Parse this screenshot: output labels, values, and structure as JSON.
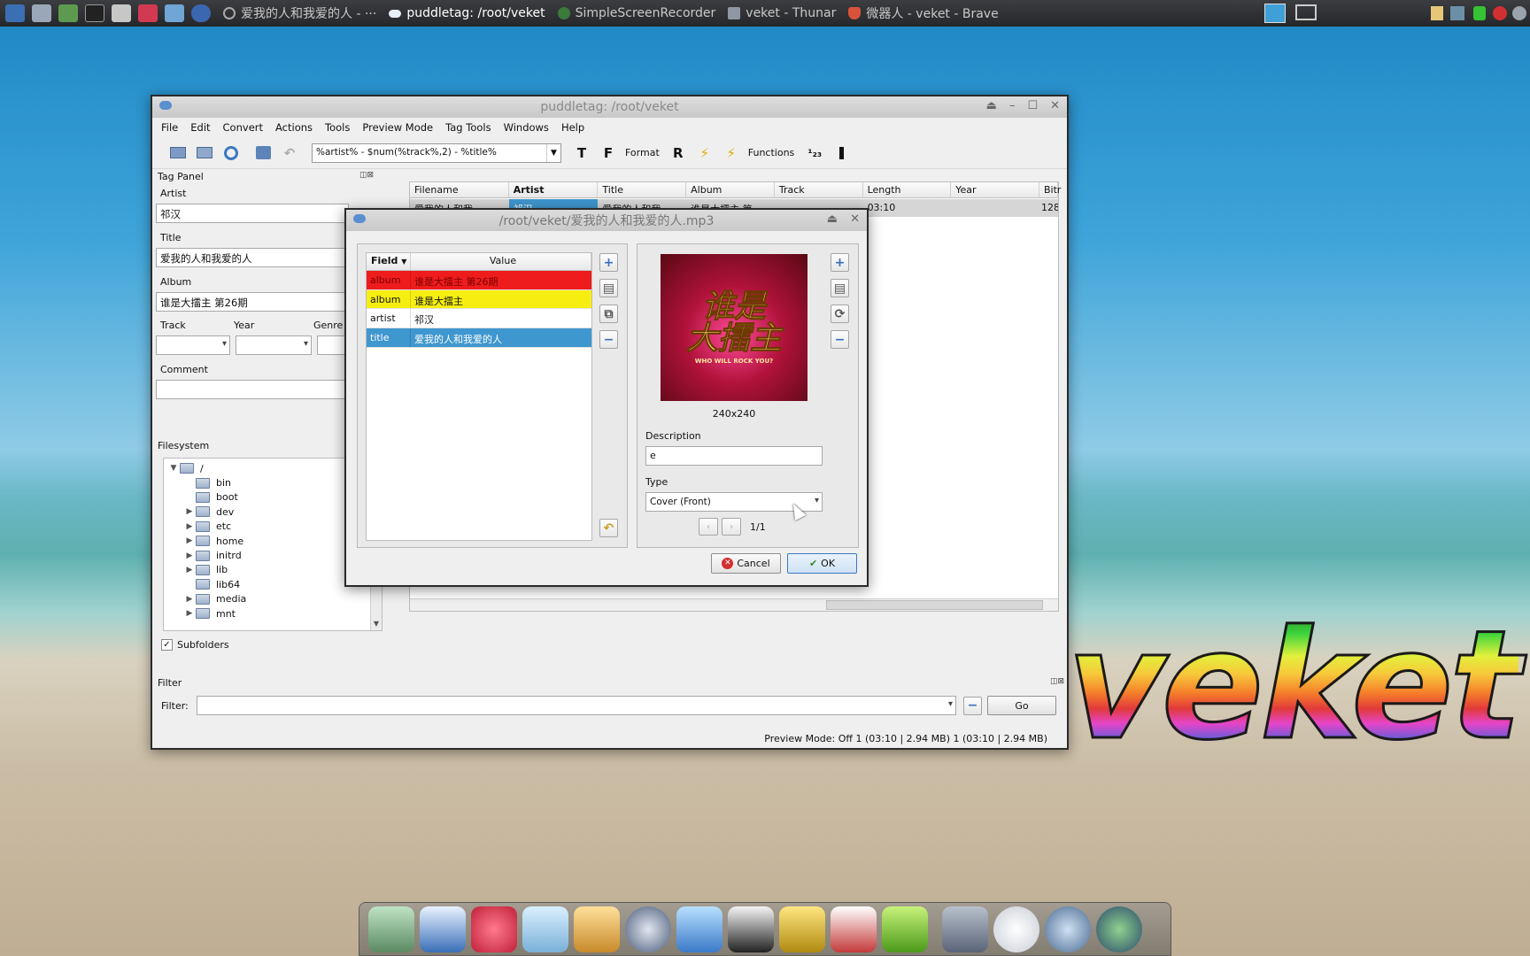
{
  "taskbar": {
    "tasks": [
      {
        "label": "爱我的人和我爱的人 - ···",
        "icon": "circle-icon"
      },
      {
        "label": "puddletag: /root/veket",
        "icon": "cloud-icon"
      },
      {
        "label": "SimpleScreenRecorder",
        "icon": "recorder-icon"
      },
      {
        "label": "veket - Thunar",
        "icon": "folder-icon"
      },
      {
        "label": "微器人 - veket - Brave",
        "icon": "brave-icon"
      }
    ]
  },
  "main": {
    "title": "puddletag: /root/veket",
    "menu": [
      "File",
      "Edit",
      "Convert",
      "Actions",
      "Tools",
      "Preview Mode",
      "Tag Tools",
      "Windows",
      "Help"
    ],
    "format_value": "%artist% - $num(%track%,2) - %title%",
    "format_label": "Format",
    "functions_label": "Functions",
    "tag_panel": {
      "title": "Tag Panel",
      "artist_label": "Artist",
      "artist_value": "祁汉",
      "title_label": "Title",
      "title_value": "爱我的人和我爱的人",
      "album_label": "Album",
      "album_value": "谁是大擂主 第26期",
      "track_label": "Track",
      "year_label": "Year",
      "genre_label": "Genre",
      "comment_label": "Comment"
    },
    "filesystem": {
      "title": "Filesystem",
      "root": "/",
      "items": [
        {
          "name": "bin",
          "expandable": false
        },
        {
          "name": "boot",
          "expandable": false
        },
        {
          "name": "dev",
          "expandable": true
        },
        {
          "name": "etc",
          "expandable": true
        },
        {
          "name": "home",
          "expandable": true
        },
        {
          "name": "initrd",
          "expandable": true
        },
        {
          "name": "lib",
          "expandable": true
        },
        {
          "name": "lib64",
          "expandable": false
        },
        {
          "name": "media",
          "expandable": true
        },
        {
          "name": "mnt",
          "expandable": true
        }
      ],
      "subfolders_label": "Subfolders"
    },
    "table": {
      "headers": [
        "Filename",
        "Artist",
        "Title",
        "Album",
        "Track",
        "Length",
        "Year",
        "Bitr"
      ],
      "row": {
        "filename": "爱我的人和我",
        "artist": "祁汉",
        "title": "爱我的人和我",
        "album": "谁是大擂主 第",
        "track": "",
        "length": "03:10",
        "year": "",
        "bitrate": "128"
      }
    },
    "filter": {
      "title": "Filter",
      "label": "Filter:",
      "go_label": "Go"
    },
    "status": "Preview Mode: Off  1 (03:10 | 2.94 MB)  1 (03:10 | 2.94 MB)"
  },
  "dialog": {
    "title": "/root/veket/爱我的人和我爱的人.mp3",
    "headers": {
      "field": "Field",
      "value": "Value"
    },
    "rows": [
      {
        "field": "album",
        "value": "谁是大擂主 第26期",
        "style": "red"
      },
      {
        "field": "album",
        "value": "谁是大擂主",
        "style": "yellow"
      },
      {
        "field": "artist",
        "value": "祁汉",
        "style": "white"
      },
      {
        "field": "title",
        "value": "爱我的人和我爱的人",
        "style": "blue"
      }
    ],
    "cover": {
      "line1": "谁是",
      "line2": "大擂主",
      "sub": "WHO WILL ROCK YOU?"
    },
    "image_size": "240x240",
    "description_label": "Description",
    "description_value": "e",
    "type_label": "Type",
    "type_value": "Cover (Front)",
    "page": "1/1",
    "cancel_label": "Cancel",
    "ok_label": "OK"
  },
  "colors": {
    "red": "#ee1c1c",
    "yellow": "#f6ee10",
    "blue": "#3f97cf",
    "selected": "#3f97cf"
  }
}
